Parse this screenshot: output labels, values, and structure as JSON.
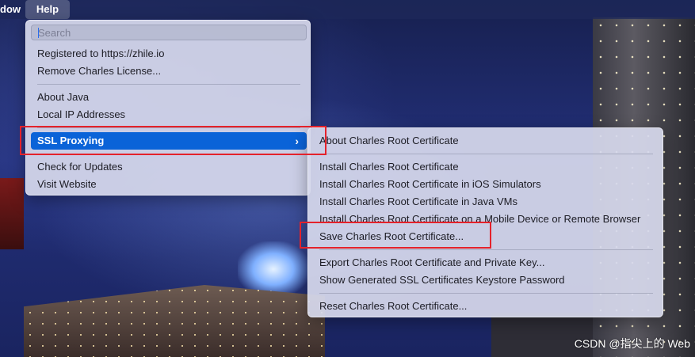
{
  "menubar": {
    "window_label": "dow",
    "help_label": "Help"
  },
  "help_menu": {
    "search_placeholder": "Search",
    "registered": "Registered to https://zhile.io",
    "remove_license": "Remove Charles License...",
    "about_java": "About Java",
    "local_ip": "Local IP Addresses",
    "ssl_proxying": "SSL Proxying",
    "check_updates": "Check for Updates",
    "visit_website": "Visit Website"
  },
  "ssl_submenu": {
    "about_root": "About Charles Root Certificate",
    "install_root": "Install Charles Root Certificate",
    "install_ios": "Install Charles Root Certificate in iOS Simulators",
    "install_java": "Install Charles Root Certificate in Java VMs",
    "install_mobile": "Install Charles Root Certificate on a Mobile Device or Remote Browser",
    "save_root": "Save Charles Root Certificate...",
    "export_root": "Export Charles Root Certificate and Private Key...",
    "show_keystore": "Show Generated SSL Certificates Keystore Password",
    "reset_root": "Reset Charles Root Certificate..."
  },
  "watermark": "CSDN @指尖上的 Web",
  "colors": {
    "highlight": "#0a63d8",
    "annotation": "#e4222b"
  }
}
